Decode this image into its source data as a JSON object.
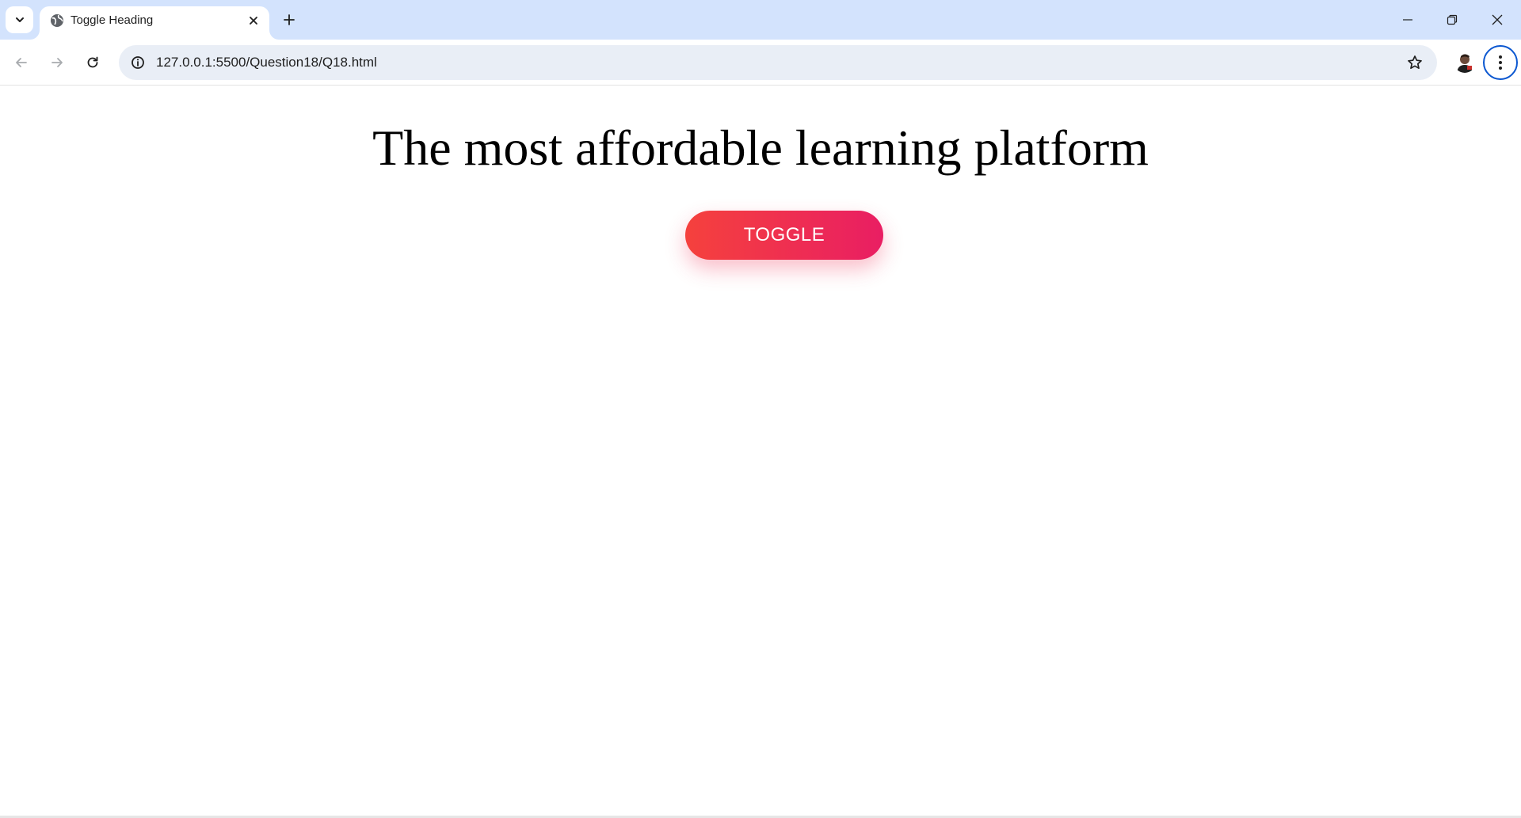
{
  "browser": {
    "tab": {
      "title": "Toggle Heading",
      "favicon": "globe-icon",
      "close_icon": "close-icon"
    },
    "new_tab_icon": "plus-icon",
    "tab_search_icon": "chevron-down-icon",
    "window_controls": [
      "minimize-icon",
      "restore-icon",
      "close-icon"
    ],
    "toolbar": {
      "back_icon": "arrow-left-icon",
      "forward_icon": "arrow-right-icon",
      "reload_icon": "reload-icon",
      "site_info_icon": "info-icon",
      "url": "127.0.0.1:5500/Question18/Q18.html",
      "bookmark_icon": "star-icon",
      "menu_icon": "kebab-menu-icon"
    },
    "colors": {
      "tabstrip": "#d3e3fd",
      "omnibox": "#e9eef6",
      "menu_ring": "#0b57d0"
    }
  },
  "page": {
    "heading": "The most affordable learning platform",
    "toggle_button": "TOGGLE",
    "colors": {
      "button_gradient_start": "#f5413d",
      "button_gradient_end": "#e91e63",
      "button_text": "#ffffff",
      "heading_text": "#000000"
    }
  }
}
